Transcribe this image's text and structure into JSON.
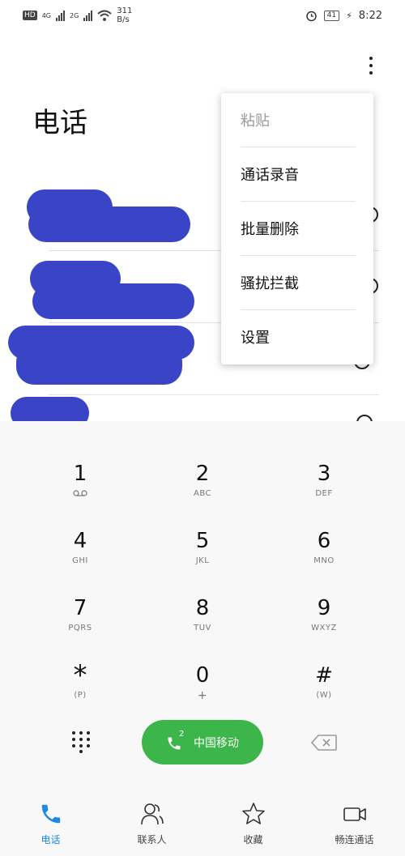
{
  "status_bar": {
    "network_left": "HD",
    "net1": "4G",
    "net2": "2G",
    "speed_value": "311",
    "speed_unit": "B/s",
    "battery": "41",
    "time": "8:22"
  },
  "header": {
    "title": "电话",
    "more_icon": "more-vert-icon"
  },
  "menu": {
    "items": [
      "粘贴",
      "通话录音",
      "批量删除",
      "骚扰拦截",
      "设置"
    ],
    "disabled_index": 0
  },
  "dialpad": {
    "keys": [
      {
        "num": "1",
        "sub": ""
      },
      {
        "num": "2",
        "sub": "ABC"
      },
      {
        "num": "3",
        "sub": "DEF"
      },
      {
        "num": "4",
        "sub": "GHI"
      },
      {
        "num": "5",
        "sub": "JKL"
      },
      {
        "num": "6",
        "sub": "MNO"
      },
      {
        "num": "7",
        "sub": "PQRS"
      },
      {
        "num": "8",
        "sub": "TUV"
      },
      {
        "num": "9",
        "sub": "WXYZ"
      },
      {
        "num": "*",
        "sub": "(P)"
      },
      {
        "num": "0",
        "sub": "+"
      },
      {
        "num": "#",
        "sub": "(W)"
      }
    ],
    "call_label": "中国移动",
    "sim_number": "2"
  },
  "bottom_nav": [
    {
      "label": "电话",
      "icon": "phone-icon",
      "active": true
    },
    {
      "label": "联系人",
      "icon": "contacts-icon",
      "active": false
    },
    {
      "label": "收藏",
      "icon": "star-icon",
      "active": false
    },
    {
      "label": "畅连通话",
      "icon": "video-call-icon",
      "active": false
    }
  ],
  "colors": {
    "accent": "#1e88e5",
    "call_green": "#3cb54a",
    "redaction": "#3a44c6"
  }
}
